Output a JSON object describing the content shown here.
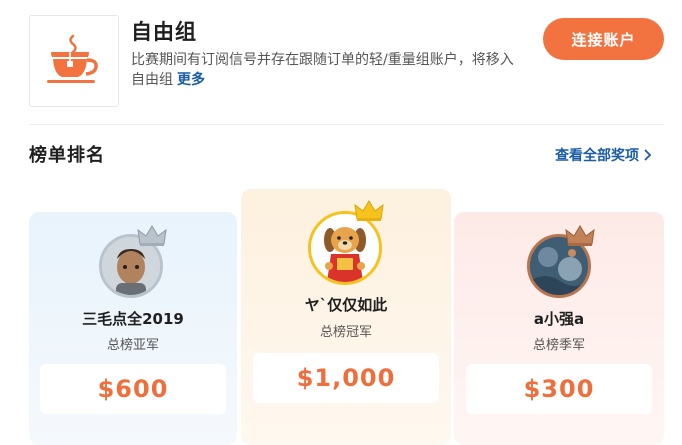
{
  "group": {
    "title": "自由组",
    "description": "比赛期间有订阅信号并存在跟随订单的轻/重量组账户，将移入自由组",
    "more_label": "更多",
    "logo_icon": "tea-cup-icon",
    "connect_label": "连接账户"
  },
  "ranking": {
    "title": "榜单排名",
    "view_all_label": "查看全部奖项"
  },
  "podium": {
    "second": {
      "name": "三毛点全2019",
      "rank_label": "总榜亚军",
      "prize": "$600",
      "crown": "silver-crown-icon"
    },
    "first": {
      "name": "ヤ`仅仅如此",
      "rank_label": "总榜冠军",
      "prize": "$1,000",
      "crown": "gold-crown-icon"
    },
    "third": {
      "name": "a小强a",
      "rank_label": "总榜季军",
      "prize": "$300",
      "crown": "bronze-crown-icon"
    }
  },
  "colors": {
    "accent": "#f2733f",
    "link": "#1a5ca8",
    "prize_text": "#ee6f3c",
    "silver": "#b9c3cc",
    "gold": "#f6c21c",
    "bronze": "#b9764e"
  }
}
